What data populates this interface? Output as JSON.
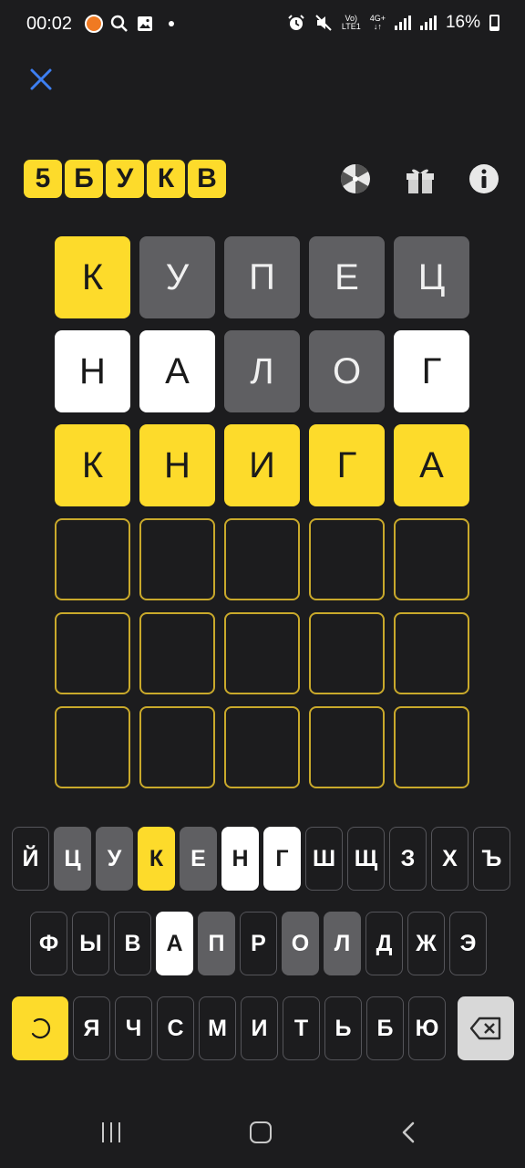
{
  "status_bar": {
    "time": "00:02",
    "battery": "16%",
    "network_top": "Vo)",
    "network_bottom": "LTE1",
    "network_type": "4G+",
    "icons": [
      "app-notification-icon",
      "search-icon",
      "gallery-icon",
      "dot-icon",
      "alarm-icon",
      "mute-icon",
      "signal-icon",
      "battery-icon"
    ]
  },
  "header": {
    "logo_letters": [
      "5",
      "Б",
      "У",
      "К",
      "В"
    ],
    "icons": [
      "close-icon",
      "wheel-icon",
      "gift-icon",
      "info-icon"
    ]
  },
  "colors": {
    "background": "#1c1c1e",
    "correct": "#fddb2b",
    "absent": "#5f5f62",
    "present": "#ffffff",
    "empty_border": "#c9a92b"
  },
  "board": {
    "rows": [
      {
        "letters": [
          "К",
          "У",
          "П",
          "Е",
          "Ц"
        ],
        "states": [
          "yellow",
          "gray",
          "gray",
          "gray",
          "gray"
        ]
      },
      {
        "letters": [
          "Н",
          "А",
          "Л",
          "О",
          "Г"
        ],
        "states": [
          "white",
          "white",
          "gray",
          "gray",
          "white"
        ]
      },
      {
        "letters": [
          "К",
          "Н",
          "И",
          "Г",
          "А"
        ],
        "states": [
          "yellow",
          "yellow",
          "yellow",
          "yellow",
          "yellow"
        ]
      },
      {
        "letters": [
          "",
          "",
          "",
          "",
          ""
        ],
        "states": [
          "empty",
          "empty",
          "empty",
          "empty",
          "empty"
        ]
      },
      {
        "letters": [
          "",
          "",
          "",
          "",
          ""
        ],
        "states": [
          "empty",
          "empty",
          "empty",
          "empty",
          "empty"
        ]
      },
      {
        "letters": [
          "",
          "",
          "",
          "",
          ""
        ],
        "states": [
          "empty",
          "empty",
          "empty",
          "empty",
          "empty"
        ]
      }
    ]
  },
  "keyboard": {
    "row1": [
      {
        "label": "Й",
        "state": "none"
      },
      {
        "label": "Ц",
        "state": "gray"
      },
      {
        "label": "У",
        "state": "gray"
      },
      {
        "label": "К",
        "state": "yellow"
      },
      {
        "label": "Е",
        "state": "gray"
      },
      {
        "label": "Н",
        "state": "white"
      },
      {
        "label": "Г",
        "state": "white"
      },
      {
        "label": "Ш",
        "state": "none"
      },
      {
        "label": "Щ",
        "state": "none"
      },
      {
        "label": "З",
        "state": "none"
      },
      {
        "label": "Х",
        "state": "none"
      },
      {
        "label": "Ъ",
        "state": "none"
      }
    ],
    "row2": [
      {
        "label": "Ф",
        "state": "none"
      },
      {
        "label": "Ы",
        "state": "none"
      },
      {
        "label": "В",
        "state": "none"
      },
      {
        "label": "А",
        "state": "white"
      },
      {
        "label": "П",
        "state": "gray"
      },
      {
        "label": "Р",
        "state": "none"
      },
      {
        "label": "О",
        "state": "gray"
      },
      {
        "label": "Л",
        "state": "gray"
      },
      {
        "label": "Д",
        "state": "none"
      },
      {
        "label": "Ж",
        "state": "none"
      },
      {
        "label": "Э",
        "state": "none"
      }
    ],
    "row3": [
      {
        "label": "Я",
        "state": "none"
      },
      {
        "label": "Ч",
        "state": "none"
      },
      {
        "label": "С",
        "state": "none"
      },
      {
        "label": "М",
        "state": "none"
      },
      {
        "label": "И",
        "state": "none"
      },
      {
        "label": "Т",
        "state": "none"
      },
      {
        "label": "Ь",
        "state": "none"
      },
      {
        "label": "Б",
        "state": "none"
      },
      {
        "label": "Ю",
        "state": "none"
      }
    ],
    "enter_icon": "loading-spinner-icon",
    "backspace_icon": "backspace-icon"
  },
  "nav_bar": {
    "icons": [
      "recent-apps-icon",
      "home-icon",
      "back-icon"
    ]
  }
}
